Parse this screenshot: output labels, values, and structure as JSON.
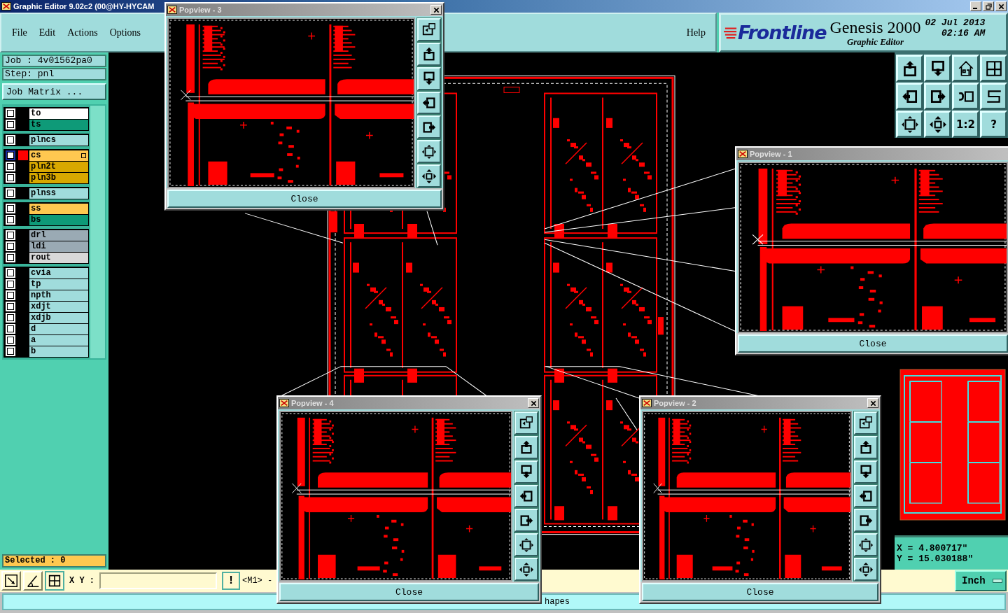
{
  "window": {
    "title": "Graphic Editor 9.02c2 (00@HY-HYCAM"
  },
  "menu": [
    {
      "label": "File"
    },
    {
      "label": "Edit"
    },
    {
      "label": "Actions"
    },
    {
      "label": "Options"
    }
  ],
  "help": "Help",
  "brand": {
    "logo": "Frontline",
    "product": "Genesis 2000",
    "subtitle": "Graphic Editor",
    "date": "02 Jul 2013",
    "time": "02:16 AM"
  },
  "job": {
    "job": "Job : 4v01562pa0",
    "step": "Step: pnl",
    "matrix": "Job Matrix ..."
  },
  "layer_groups": [
    [
      {
        "name": "to",
        "color": "#ffffff",
        "selected": false,
        "checked": false
      },
      {
        "name": "ts",
        "color": "#0e9a78",
        "selected": false,
        "checked": false
      }
    ],
    [
      {
        "name": "plncs",
        "color": "#a0dcdc",
        "selected": false,
        "checked": false
      }
    ],
    [
      {
        "name": "cs",
        "color": "#ffc850",
        "selected": true,
        "checked": false
      },
      {
        "name": "pln2t",
        "color": "#d8a800",
        "selected": false,
        "checked": false
      },
      {
        "name": "pln3b",
        "color": "#d8a800",
        "selected": false,
        "checked": false
      }
    ],
    [
      {
        "name": "plnss",
        "color": "#a0dcdc",
        "selected": false,
        "checked": false
      }
    ],
    [
      {
        "name": "ss",
        "color": "#ffc850",
        "selected": false,
        "checked": false
      },
      {
        "name": "bs",
        "color": "#0e9a78",
        "selected": false,
        "checked": false
      }
    ],
    [
      {
        "name": "drl",
        "color": "#9aaab4",
        "selected": false,
        "checked": false
      },
      {
        "name": "ldi",
        "color": "#9aaab4",
        "selected": false,
        "checked": false
      },
      {
        "name": "rout",
        "color": "#d8d8d8",
        "selected": false,
        "checked": false
      }
    ],
    [
      {
        "name": "cvia",
        "color": "#a0dcdc",
        "selected": false,
        "checked": false
      },
      {
        "name": "tp",
        "color": "#a0dcdc",
        "selected": false,
        "checked": false
      },
      {
        "name": "npth",
        "color": "#a0dcdc",
        "selected": false,
        "checked": false
      },
      {
        "name": "xdjt",
        "color": "#a0dcdc",
        "selected": false,
        "checked": false
      },
      {
        "name": "xdjb",
        "color": "#a0dcdc",
        "selected": false,
        "checked": false
      },
      {
        "name": "d",
        "color": "#a0dcdc",
        "selected": false,
        "checked": false
      },
      {
        "name": "a",
        "color": "#a0dcdc",
        "selected": false,
        "checked": false
      },
      {
        "name": "b",
        "color": "#a0dcdc",
        "selected": false,
        "checked": false
      }
    ]
  ],
  "selected_count": "Selected : 0",
  "toolbar": [
    {
      "kind": "icon"
    },
    {
      "kind": "icon"
    },
    {
      "kind": "icon"
    },
    {
      "kind": "icon"
    },
    {
      "kind": "icon"
    },
    {
      "kind": "icon"
    },
    {
      "kind": "icon"
    },
    {
      "kind": "icon"
    },
    {
      "kind": "icon"
    },
    {
      "kind": "icon"
    },
    {
      "kind": "text",
      "label": "1:2"
    },
    {
      "kind": "text",
      "label": "?"
    }
  ],
  "coords": {
    "x": "X = 4.800717\"",
    "y": "Y = 15.030188\""
  },
  "command": {
    "label": "X Y :",
    "bang": "!",
    "mode": "<M1> -"
  },
  "units": "Inch",
  "status": "hapes",
  "popviews": [
    {
      "title": "Popview - 3",
      "close": "Close"
    },
    {
      "title": "Popview - 1",
      "close": "Close"
    },
    {
      "title": "Popview - 4",
      "close": "Close"
    },
    {
      "title": "Popview - 2",
      "close": "Close"
    }
  ]
}
